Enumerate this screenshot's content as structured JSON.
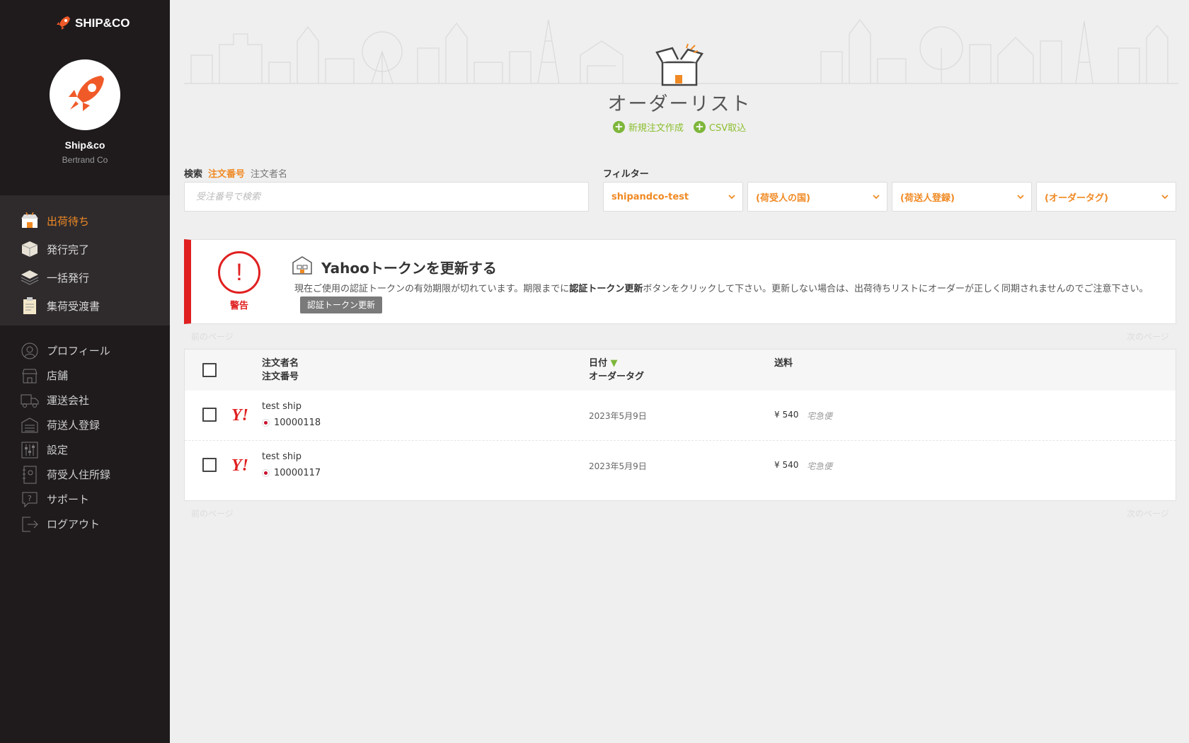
{
  "brand": {
    "logo_text": "SHIP&CO"
  },
  "account": {
    "name": "Ship&co",
    "company": "Bertrand Co"
  },
  "nav_primary": [
    {
      "label": "出荷待ち",
      "icon": "store-box-icon",
      "active": true
    },
    {
      "label": "発行完了",
      "icon": "package-icon",
      "active": false
    },
    {
      "label": "一括発行",
      "icon": "stack-icon",
      "active": false
    },
    {
      "label": "集荷受渡書",
      "icon": "clipboard-icon",
      "active": false
    }
  ],
  "nav_secondary": [
    {
      "label": "プロフィール",
      "icon": "user-icon"
    },
    {
      "label": "店舗",
      "icon": "shop-icon"
    },
    {
      "label": "運送会社",
      "icon": "truck-icon"
    },
    {
      "label": "荷送人登録",
      "icon": "warehouse-icon"
    },
    {
      "label": "設定",
      "icon": "sliders-icon"
    },
    {
      "label": "荷受人住所録",
      "icon": "address-book-icon"
    },
    {
      "label": "サポート",
      "icon": "help-icon"
    },
    {
      "label": "ログアウト",
      "icon": "logout-icon"
    }
  ],
  "header": {
    "title": "オーダーリスト",
    "new_order": "新規注文作成",
    "csv_import": "CSV取込"
  },
  "search": {
    "label": "検索",
    "tab_order_no": "注文番号",
    "tab_customer": "注文者名",
    "placeholder": "受注番号で検索"
  },
  "filter": {
    "label": "フィルター",
    "selects": [
      "shipandco-test",
      "(荷受人の国)",
      "(荷送人登録)",
      "(オーダータグ)"
    ]
  },
  "alert": {
    "warning_label": "警告",
    "title": "Yahooトークンを更新する",
    "body_1": "現在ご使用の認証トークンの有効期限が切れています。期限までに",
    "body_bold": "認証トークン更新",
    "body_2": "ボタンをクリックして下さい。更新しない場合は、出荷待ちリストにオーダーが正しく同期されませんのでご注意下さい。",
    "button": "認証トークン更新"
  },
  "pager": {
    "prev": "前のページ",
    "next": "次のページ"
  },
  "table": {
    "col_customer": "注文者名",
    "col_order_no": "注文番号",
    "col_date": "日付",
    "col_tag": "オーダータグ",
    "col_shipping": "送料",
    "rows": [
      {
        "customer": "test ship",
        "order_no": "10000118",
        "date": "2023年5月9日",
        "price": "¥ 540",
        "service": "宅急便"
      },
      {
        "customer": "test ship",
        "order_no": "10000117",
        "date": "2023年5月9日",
        "price": "¥ 540",
        "service": "宅急便"
      }
    ]
  },
  "colors": {
    "accent": "#f08a24",
    "alert": "#e02020",
    "green": "#7db63a",
    "sidebar": "#1f1b1d"
  }
}
